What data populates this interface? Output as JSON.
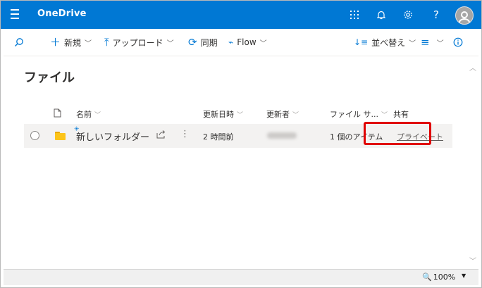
{
  "app": {
    "title": "OneDrive"
  },
  "topbar_icons": [
    {
      "name": "app-launcher-icon",
      "glyph": "⋮⋮⋮"
    },
    {
      "name": "notification-bell-icon",
      "glyph": "🔔"
    },
    {
      "name": "settings-gear-icon",
      "glyph": "⚙"
    },
    {
      "name": "help-icon",
      "glyph": "?"
    }
  ],
  "toolbar": {
    "new_label": "新規",
    "upload_label": "アップロード",
    "sync_label": "同期",
    "flow_label": "Flow",
    "sort_label": "並べ替え"
  },
  "page": {
    "title": "ファイル"
  },
  "table": {
    "headers": {
      "name": "名前",
      "modified": "更新日時",
      "modified_by": "更新者",
      "file_size": "ファイル サ...",
      "sharing": "共有"
    },
    "rows": [
      {
        "name": "新しいフォルダー",
        "modified": "2 時間前",
        "file_size": "1 個のアイテム",
        "sharing": "プライベート"
      }
    ]
  },
  "status": {
    "zoom": "100%"
  },
  "colors": {
    "brand": "#0078d4",
    "highlight": "#e00000",
    "folder": "#fcc419"
  }
}
